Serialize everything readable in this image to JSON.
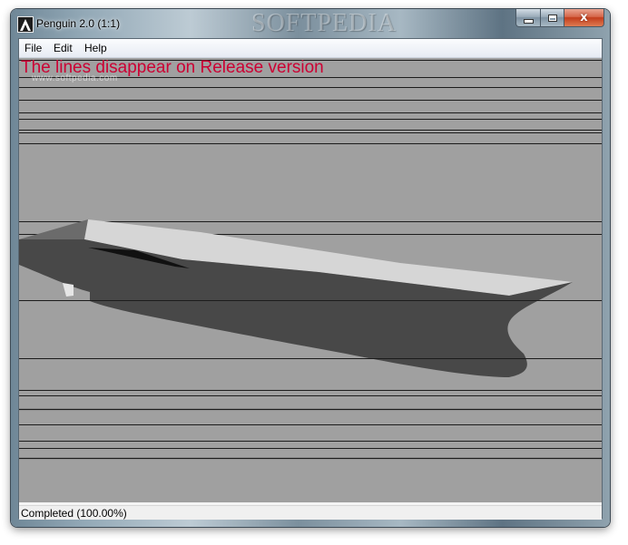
{
  "window": {
    "title": "Penguin 2.0 (1:1)",
    "watermark": "SOFTPEDIA",
    "watermark_small": "www.softpedia.com"
  },
  "caption_buttons": {
    "close_glyph": "x",
    "min_icon": "minimize-icon",
    "max_icon": "maximize-icon",
    "close_icon": "close-icon"
  },
  "menu": {
    "items": [
      "File",
      "Edit",
      "Help"
    ]
  },
  "viewport": {
    "overlay_text": "The lines disappear on Release version",
    "overlay_color": "#cc0033",
    "background_color": "#a0a0a0"
  },
  "status": {
    "text": "Completed (100.00%)"
  }
}
